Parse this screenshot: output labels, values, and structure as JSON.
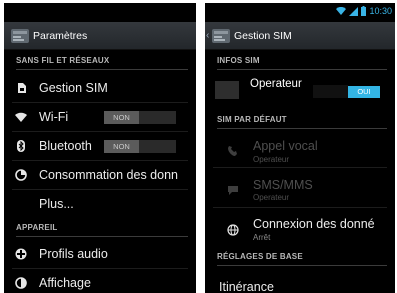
{
  "left_screen": {
    "title": "Paramètres",
    "sections": [
      {
        "header": "SANS FIL ET RÉSEAUX"
      },
      {
        "header": "APPAREIL"
      }
    ],
    "items": [
      {
        "label": "Gestion SIM",
        "icon": "sim-card-icon"
      },
      {
        "label": "Wi-Fi",
        "icon": "wifi-icon",
        "toggle": "NON"
      },
      {
        "label": "Bluetooth",
        "icon": "bluetooth-icon",
        "toggle": "NON"
      },
      {
        "label": "Consommation des donn",
        "icon": "data-usage-icon"
      },
      {
        "label": "Plus..."
      },
      {
        "label": "Profils audio",
        "icon": "audio-profiles-icon"
      },
      {
        "label": "Affichage",
        "icon": "display-icon"
      }
    ]
  },
  "right_screen": {
    "status_time": "10:30",
    "title": "Gestion SIM",
    "infos_header": "INFOS SIM",
    "operator": {
      "name": "Operateur",
      "toggle": "OUI"
    },
    "default_header": "SIM PAR DÉFAUT",
    "default_items": [
      {
        "title": "Appel vocal",
        "subtitle": "Operateur",
        "icon": "phone-icon",
        "enabled": false
      },
      {
        "title": "SMS/MMS",
        "subtitle": "Operateur",
        "icon": "message-icon",
        "enabled": false
      },
      {
        "title": "Connexion des donné",
        "subtitle": "Arrêt",
        "icon": "globe-icon",
        "enabled": true
      }
    ],
    "basic_header": "RÉGLAGES DE BASE",
    "itinerance": "Itinérance"
  },
  "colors": {
    "accent": "#33b5e5",
    "background": "#000000",
    "text": "#ececec",
    "header_text": "#b8b8b8",
    "disabled_text": "#4f4f4f"
  }
}
